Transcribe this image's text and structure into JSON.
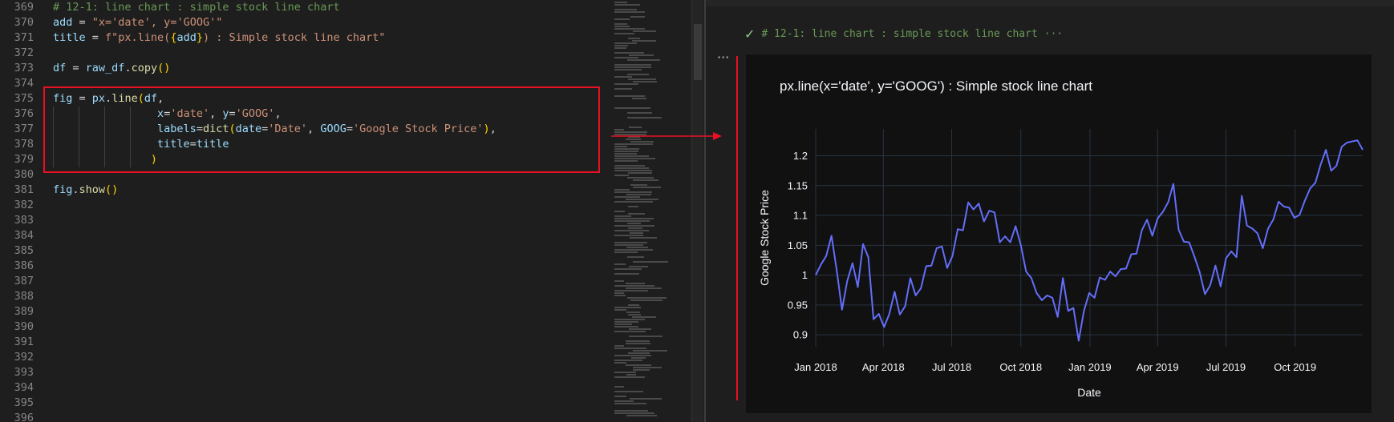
{
  "editor": {
    "lines": [
      {
        "no": "369",
        "tokens": [
          {
            "t": "# 12-1: line chart : simple stock line chart",
            "c": "cm"
          }
        ]
      },
      {
        "no": "370",
        "tokens": [
          {
            "t": "add",
            "c": "vr"
          },
          {
            "t": " = ",
            "c": "op"
          },
          {
            "t": "\"x='date', y='GOOG'\"",
            "c": "st"
          }
        ]
      },
      {
        "no": "371",
        "tokens": [
          {
            "t": "title",
            "c": "vr"
          },
          {
            "t": " = ",
            "c": "op"
          },
          {
            "t": "f\"px.line(",
            "c": "st"
          },
          {
            "t": "{",
            "c": "bk"
          },
          {
            "t": "add",
            "c": "vr"
          },
          {
            "t": "}",
            "c": "bk"
          },
          {
            "t": ") : Simple stock line chart\"",
            "c": "st"
          }
        ]
      },
      {
        "no": "372",
        "tokens": []
      },
      {
        "no": "373",
        "tokens": [
          {
            "t": "df",
            "c": "vr"
          },
          {
            "t": " = ",
            "c": "op"
          },
          {
            "t": "raw_df",
            "c": "vr"
          },
          {
            "t": ".",
            "c": "op"
          },
          {
            "t": "copy",
            "c": "fn"
          },
          {
            "t": "()",
            "c": "bk"
          }
        ]
      },
      {
        "no": "374",
        "tokens": []
      },
      {
        "no": "375",
        "tokens": [
          {
            "t": "fig",
            "c": "vr"
          },
          {
            "t": " = ",
            "c": "op"
          },
          {
            "t": "px",
            "c": "vr"
          },
          {
            "t": ".",
            "c": "op"
          },
          {
            "t": "line",
            "c": "fn"
          },
          {
            "t": "(",
            "c": "bk"
          },
          {
            "t": "df",
            "c": "vr"
          },
          {
            "t": ",",
            "c": "op"
          }
        ]
      },
      {
        "no": "376",
        "tokens": [
          {
            "t": "                ",
            "c": "op"
          },
          {
            "t": "x",
            "c": "vr"
          },
          {
            "t": "=",
            "c": "op"
          },
          {
            "t": "'date'",
            "c": "st"
          },
          {
            "t": ", ",
            "c": "op"
          },
          {
            "t": "y",
            "c": "vr"
          },
          {
            "t": "=",
            "c": "op"
          },
          {
            "t": "'GOOG'",
            "c": "st"
          },
          {
            "t": ",",
            "c": "op"
          }
        ]
      },
      {
        "no": "377",
        "tokens": [
          {
            "t": "                ",
            "c": "op"
          },
          {
            "t": "labels",
            "c": "vr"
          },
          {
            "t": "=",
            "c": "op"
          },
          {
            "t": "dict",
            "c": "fn"
          },
          {
            "t": "(",
            "c": "bk"
          },
          {
            "t": "date",
            "c": "vr"
          },
          {
            "t": "=",
            "c": "op"
          },
          {
            "t": "'Date'",
            "c": "st"
          },
          {
            "t": ", ",
            "c": "op"
          },
          {
            "t": "GOOG",
            "c": "vr"
          },
          {
            "t": "=",
            "c": "op"
          },
          {
            "t": "'Google Stock Price'",
            "c": "st"
          },
          {
            "t": ")",
            "c": "bk"
          },
          {
            "t": ",",
            "c": "op"
          }
        ]
      },
      {
        "no": "378",
        "tokens": [
          {
            "t": "                ",
            "c": "op"
          },
          {
            "t": "title",
            "c": "vr"
          },
          {
            "t": "=",
            "c": "op"
          },
          {
            "t": "title",
            "c": "vr"
          }
        ]
      },
      {
        "no": "379",
        "tokens": [
          {
            "t": "               ",
            "c": "op"
          },
          {
            "t": ")",
            "c": "bk"
          }
        ]
      },
      {
        "no": "380",
        "tokens": []
      },
      {
        "no": "381",
        "tokens": [
          {
            "t": "fig",
            "c": "vr"
          },
          {
            "t": ".",
            "c": "op"
          },
          {
            "t": "show",
            "c": "fn"
          },
          {
            "t": "()",
            "c": "bk"
          }
        ]
      },
      {
        "no": "382",
        "tokens": []
      },
      {
        "no": "383",
        "tokens": []
      },
      {
        "no": "384",
        "tokens": []
      },
      {
        "no": "385",
        "tokens": []
      },
      {
        "no": "386",
        "tokens": []
      },
      {
        "no": "387",
        "tokens": []
      },
      {
        "no": "388",
        "tokens": []
      },
      {
        "no": "389",
        "tokens": []
      },
      {
        "no": "390",
        "tokens": []
      },
      {
        "no": "391",
        "tokens": []
      },
      {
        "no": "392",
        "tokens": []
      },
      {
        "no": "393",
        "tokens": []
      },
      {
        "no": "394",
        "tokens": []
      },
      {
        "no": "395",
        "tokens": []
      },
      {
        "no": "396",
        "tokens": []
      }
    ]
  },
  "output": {
    "cell_header": "# 12-1: line chart : simple stock line chart",
    "cell_header_more": "···",
    "more_icon": "···"
  },
  "colors": {
    "line": "#636efa",
    "plot_bg": "#111111",
    "grid": "#283442",
    "axis_text": "#f2f5fa",
    "highlight_box": "#e81123"
  },
  "chart_data": {
    "type": "line",
    "title": "px.line(x='date', y='GOOG') : Simple stock line chart",
    "xlabel": "Date",
    "ylabel": "Google Stock Price",
    "x_tick_labels": [
      "Jan 2018",
      "Apr 2018",
      "Jul 2018",
      "Oct 2018",
      "Jan 2019",
      "Apr 2019",
      "Jul 2019",
      "Oct 2019"
    ],
    "y_tick_labels": [
      "0.9",
      "0.95",
      "1",
      "1.05",
      "1.1",
      "1.15",
      "1.2"
    ],
    "y_ticks": [
      0.9,
      0.95,
      1.0,
      1.05,
      1.1,
      1.15,
      1.2
    ],
    "ylim": [
      0.88,
      1.245
    ],
    "xlim": [
      "2018-01-01",
      "2019-12-30"
    ],
    "grid": true,
    "series": [
      {
        "x": [
          "2018-01-01",
          "2018-01-08",
          "2018-01-15",
          "2018-01-22",
          "2018-01-29",
          "2018-02-05",
          "2018-02-12",
          "2018-02-19",
          "2018-02-26",
          "2018-03-05",
          "2018-03-12",
          "2018-03-19",
          "2018-03-26",
          "2018-04-02",
          "2018-04-09",
          "2018-04-16",
          "2018-04-23",
          "2018-04-30",
          "2018-05-07",
          "2018-05-14",
          "2018-05-21",
          "2018-05-28",
          "2018-06-04",
          "2018-06-11",
          "2018-06-18",
          "2018-06-25",
          "2018-07-02",
          "2018-07-09",
          "2018-07-16",
          "2018-07-23",
          "2018-07-30",
          "2018-08-06",
          "2018-08-13",
          "2018-08-20",
          "2018-08-27",
          "2018-09-03",
          "2018-09-10",
          "2018-09-17",
          "2018-09-24",
          "2018-10-01",
          "2018-10-08",
          "2018-10-15",
          "2018-10-22",
          "2018-10-29",
          "2018-11-05",
          "2018-11-12",
          "2018-11-19",
          "2018-11-26",
          "2018-12-03",
          "2018-12-10",
          "2018-12-17",
          "2018-12-24",
          "2018-12-31",
          "2019-01-07",
          "2019-01-14",
          "2019-01-21",
          "2019-01-28",
          "2019-02-04",
          "2019-02-11",
          "2019-02-18",
          "2019-02-25",
          "2019-03-04",
          "2019-03-11",
          "2019-03-18",
          "2019-03-25",
          "2019-04-01",
          "2019-04-08",
          "2019-04-15",
          "2019-04-22",
          "2019-04-29",
          "2019-05-06",
          "2019-05-13",
          "2019-05-20",
          "2019-05-27",
          "2019-06-03",
          "2019-06-10",
          "2019-06-17",
          "2019-06-24",
          "2019-07-01",
          "2019-07-08",
          "2019-07-15",
          "2019-07-22",
          "2019-07-29",
          "2019-08-05",
          "2019-08-12",
          "2019-08-19",
          "2019-08-26",
          "2019-09-02",
          "2019-09-09",
          "2019-09-16",
          "2019-09-23",
          "2019-09-30",
          "2019-10-07",
          "2019-10-14",
          "2019-10-21",
          "2019-10-28",
          "2019-11-04",
          "2019-11-11",
          "2019-11-18",
          "2019-11-25",
          "2019-12-02",
          "2019-12-09",
          "2019-12-16",
          "2019-12-23",
          "2019-12-30"
        ],
        "y": [
          1.0,
          1.018,
          1.032,
          1.066,
          1.008,
          0.942,
          0.99,
          1.02,
          0.98,
          1.052,
          1.03,
          0.926,
          0.935,
          0.913,
          0.935,
          0.972,
          0.934,
          0.948,
          0.995,
          0.966,
          0.978,
          1.015,
          1.016,
          1.045,
          1.048,
          1.012,
          1.032,
          1.077,
          1.075,
          1.122,
          1.11,
          1.12,
          1.09,
          1.108,
          1.105,
          1.055,
          1.065,
          1.055,
          1.082,
          1.05,
          1.006,
          0.995,
          0.97,
          0.958,
          0.966,
          0.962,
          0.93,
          0.995,
          0.94,
          0.945,
          0.89,
          0.94,
          0.97,
          0.962,
          0.996,
          0.992,
          1.006,
          0.998,
          1.01,
          1.011,
          1.035,
          1.036,
          1.075,
          1.093,
          1.066,
          1.095,
          1.106,
          1.122,
          1.153,
          1.076,
          1.056,
          1.055,
          1.031,
          1.005,
          0.968,
          0.983,
          1.016,
          0.981,
          1.028,
          1.04,
          1.03,
          1.133,
          1.083,
          1.078,
          1.07,
          1.045,
          1.078,
          1.093,
          1.123,
          1.115,
          1.113,
          1.096,
          1.101,
          1.125,
          1.145,
          1.155,
          1.185,
          1.21,
          1.175,
          1.183,
          1.215,
          1.222,
          1.224,
          1.226,
          1.21
        ]
      }
    ]
  }
}
